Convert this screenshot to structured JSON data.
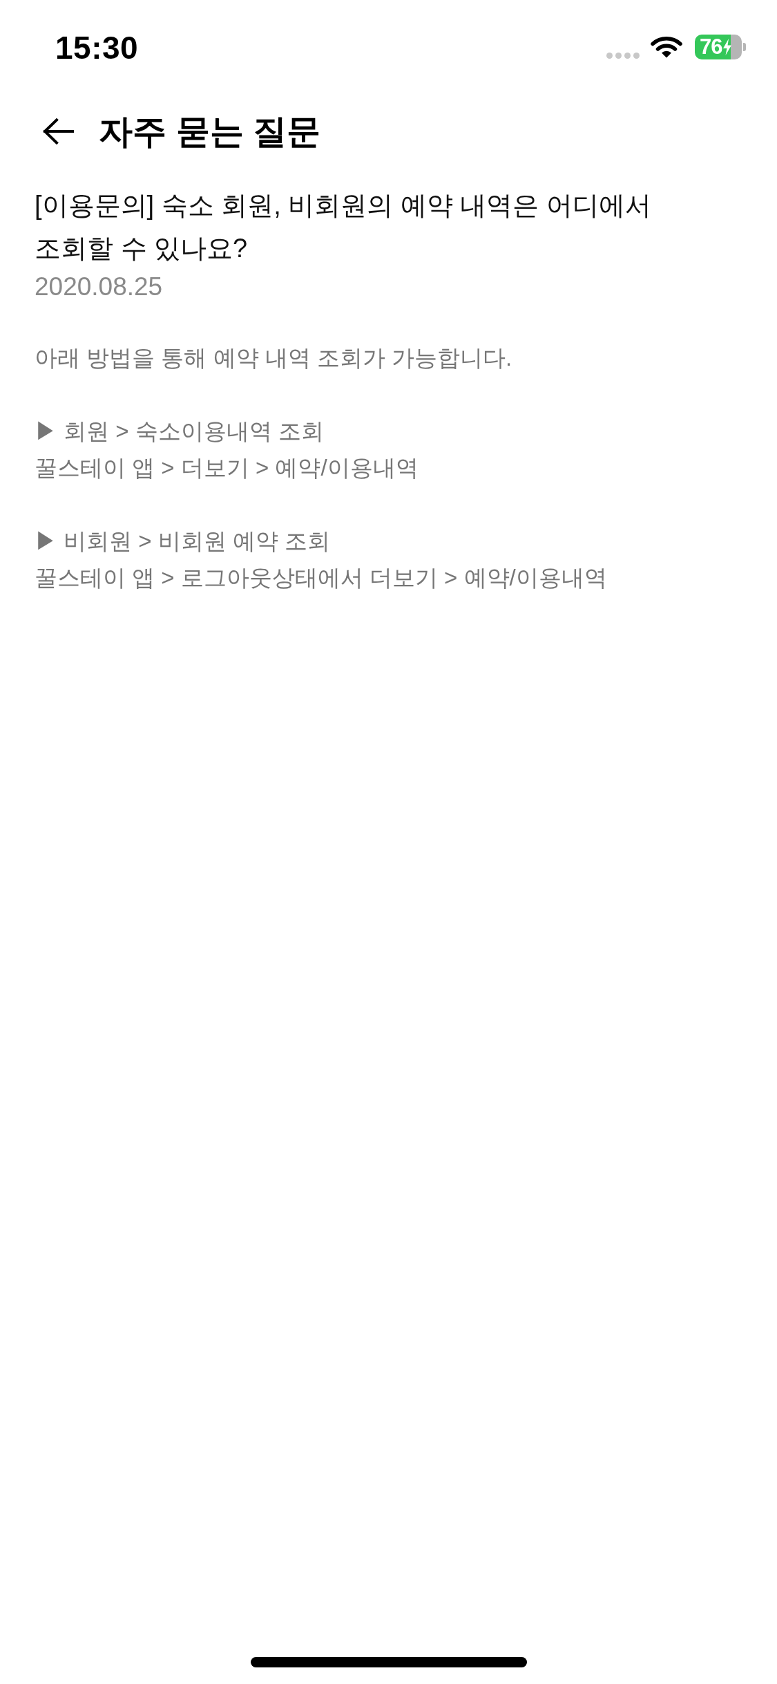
{
  "status_bar": {
    "time": "15:30",
    "battery": "76",
    "charging": true
  },
  "header": {
    "title": "자주 묻는 질문"
  },
  "article": {
    "question": "[이용문의] 숙소 회원, 비회원의 예약 내역은 어디에서 조회할 수 있나요?",
    "date": "2020.08.25",
    "intro": "아래 방법을 통해 예약 내역 조회가 가능합니다.",
    "sections": [
      {
        "heading": "▶ 회원 > 숙소이용내역 조회",
        "path": "꿀스테이 앱 > 더보기 > 예약/이용내역"
      },
      {
        "heading": "▶ 비회원 > 비회원 예약 조회",
        "path": "꿀스테이 앱 > 로그아웃상태에서 더보기 > 예약/이용내역"
      }
    ]
  }
}
